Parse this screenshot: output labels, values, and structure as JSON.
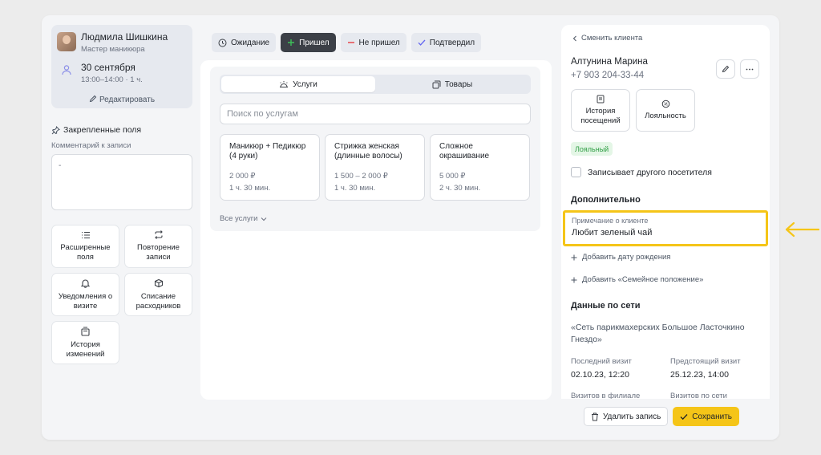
{
  "master": {
    "name": "Людмила Шишкина",
    "role": "Мастер маникюра",
    "date": "30 сентября",
    "time": "13:00–14:00 · 1 ч.",
    "edit_label": "Редактировать"
  },
  "pinned": {
    "title": "Закрепленные поля",
    "comment_label": "Комментарий к записи",
    "comment_value": "-"
  },
  "tiles": [
    {
      "label": "Расширенные поля",
      "icon": "list-icon"
    },
    {
      "label": "Повторение записи",
      "icon": "repeat-icon"
    },
    {
      "label": "Уведомления о визите",
      "icon": "bell-icon"
    },
    {
      "label": "Списание расходников",
      "icon": "box-icon"
    },
    {
      "label": "История изменений",
      "icon": "history-icon"
    }
  ],
  "statuses": [
    {
      "label": "Ожидание",
      "icon": "clock-icon"
    },
    {
      "label": "Пришел",
      "icon": "plus-icon"
    },
    {
      "label": "Не пришел",
      "icon": "minus-icon"
    },
    {
      "label": "Подтвердил",
      "icon": "check-icon"
    }
  ],
  "active_status": "Пришел",
  "tabs": {
    "services": "Услуги",
    "products": "Товары"
  },
  "search": {
    "placeholder": "Поиск по услугам"
  },
  "services": [
    {
      "name": "Маникюр + Педикюр (4 руки)",
      "price": "2 000 ₽",
      "duration": "1 ч. 30 мин."
    },
    {
      "name": "Стрижка женская (длинные волосы)",
      "price": "1 500 – 2 000 ₽",
      "duration": "1 ч. 30 мин."
    },
    {
      "name": "Сложное окрашивание",
      "price": "5 000 ₽",
      "duration": "2 ч. 30 мин."
    }
  ],
  "all_services_label": "Все услуги",
  "client": {
    "back_label": "Сменить клиента",
    "name": "Алтунина Марина",
    "phone": "+7 903 204-33-44",
    "history_label": "История посещений",
    "loyalty_label": "Лояльность",
    "badge": "Лояльный",
    "other_visitor_label": "Записывает другого посетителя"
  },
  "extra": {
    "title": "Дополнительно",
    "note_label": "Примечание о клиенте",
    "note_value": "Любит зеленый чай",
    "add_birthday": "Добавить дату рождения",
    "add_family": "Добавить «Семейное положение»"
  },
  "network": {
    "title": "Данные по сети",
    "name": "«Сеть парикмахерских Большое Ласточкино Гнездо»",
    "last_visit_label": "Последний визит",
    "last_visit_value": "02.10.23, 12:20",
    "next_visit_label": "Предстоящий визит",
    "next_visit_value": "25.12.23, 14:00",
    "branch_visits_label": "Визитов в филиале",
    "network_visits_label": "Визитов по сети"
  },
  "actions": {
    "delete": "Удалить запись",
    "save": "Сохранить"
  },
  "colors": {
    "accent": "#f5c518",
    "active_status_bg": "#3c4047",
    "badge_green": "#2f9e44"
  }
}
